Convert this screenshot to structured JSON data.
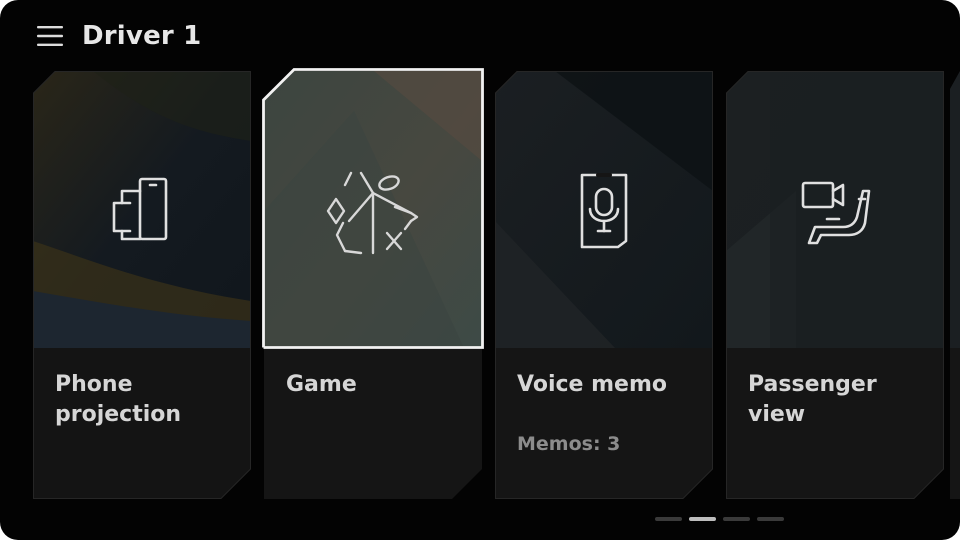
{
  "header": {
    "menu_icon": "hamburger-menu-icon",
    "title": "Driver 1"
  },
  "cards": [
    {
      "label": "Phone projection",
      "sub": "",
      "icon": "phone-projection-icon",
      "selected": false
    },
    {
      "label": "Game",
      "sub": "",
      "icon": "game-icon",
      "selected": true
    },
    {
      "label": "Voice memo",
      "sub": "Memos: 3",
      "icon": "microphone-icon",
      "selected": false
    },
    {
      "label": "Passenger view",
      "sub": "",
      "icon": "passenger-view-icon",
      "selected": false
    }
  ],
  "pager": {
    "pages": 4,
    "active_index": 1
  },
  "colors": {
    "background": "#030303",
    "card": "#151515",
    "text": "#d6d6d6",
    "subtext": "#8c8c8c",
    "selection": "#ffffff"
  }
}
